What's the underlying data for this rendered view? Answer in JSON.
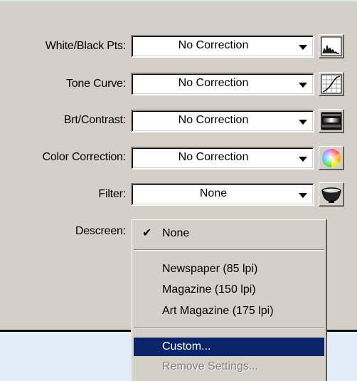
{
  "rows": [
    {
      "label": "White/Black Pts:",
      "value": "No Correction",
      "icon": "histogram-icon"
    },
    {
      "label": "Tone Curve:",
      "value": "No Correction",
      "icon": "curve-icon"
    },
    {
      "label": "Brt/Contrast:",
      "value": "No Correction",
      "icon": "gradient-icon"
    },
    {
      "label": "Color Correction:",
      "value": "No Correction",
      "icon": "color-wheel-icon"
    },
    {
      "label": "Filter:",
      "value": "None",
      "icon": "bowl-icon"
    }
  ],
  "descreen": {
    "label": "Descreen:",
    "menu": {
      "check_glyph": "✔",
      "items": [
        {
          "label": "None",
          "checked": true
        },
        {
          "label": "Newspaper (85 lpi)"
        },
        {
          "label": "Magazine (150 lpi)"
        },
        {
          "label": "Art Magazine (175 lpi)"
        },
        {
          "label": "Custom...",
          "selected": true
        },
        {
          "label": "Remove Settings...",
          "disabled": true
        }
      ]
    }
  },
  "colors": {
    "panel": "#d4d0c8",
    "background": "#e3edf7",
    "highlight": "#0a246a"
  }
}
